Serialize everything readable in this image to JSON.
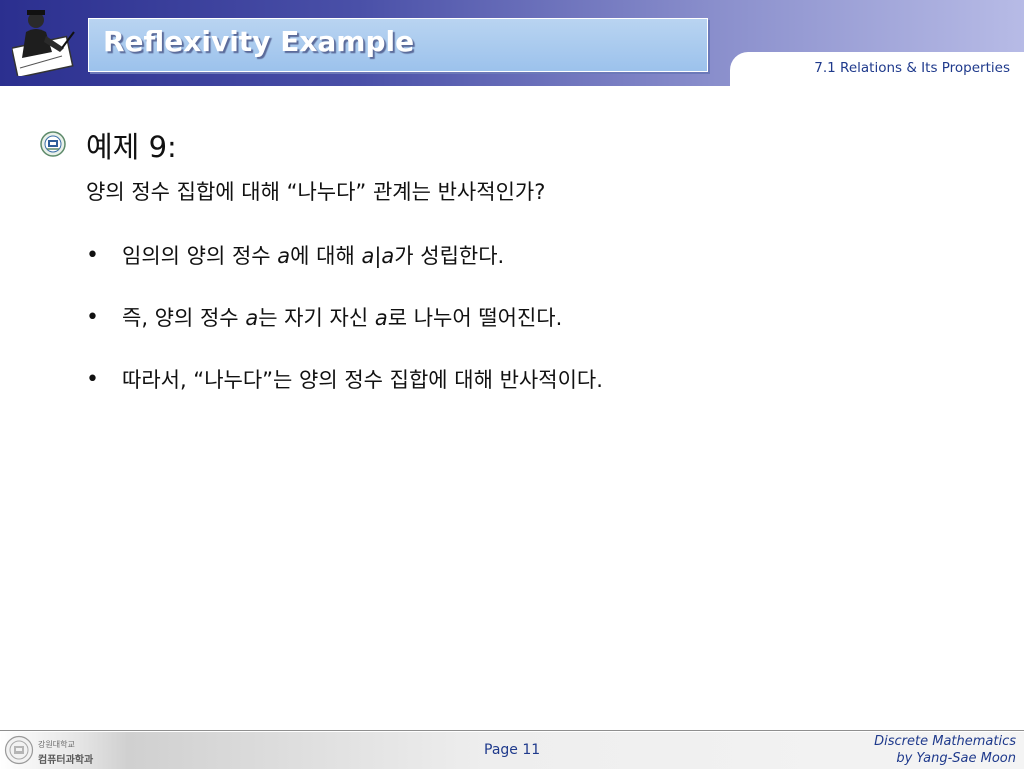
{
  "header": {
    "title": "Reflexivity Example",
    "section": "7.1 Relations & Its Properties"
  },
  "content": {
    "heading": "예제 9:",
    "question": "양의 정수 집합에 대해 “나누다” 관계는 반사적인가?",
    "bullets": [
      {
        "symbol": "•",
        "p1": "임의의 양의 정수 ",
        "v1": "a",
        "p2": "에 대해 ",
        "v2": "a|a",
        "p3": "가 성립한다."
      },
      {
        "symbol": "•",
        "p1": "즉, 양의 정수 ",
        "v1": "a",
        "p2": "는 자기 자신 ",
        "v2": "a",
        "p3": "로 나누어 떨어진다."
      },
      {
        "symbol": "•",
        "p1": "따라서, “나누다”는 양의 정수 집합에 대해 반사적이다."
      }
    ]
  },
  "footer": {
    "dept_line1": "강원대학교",
    "dept_line2": "컴퓨터과학과",
    "page": "Page 11",
    "credit_line1": "Discrete Mathematics",
    "credit_line2": "by Yang-Sae Moon"
  },
  "icons": {
    "header_logo": "scholar-writing-icon",
    "heading_bullet": "university-emblem-icon",
    "footer_seal": "university-seal-icon"
  }
}
